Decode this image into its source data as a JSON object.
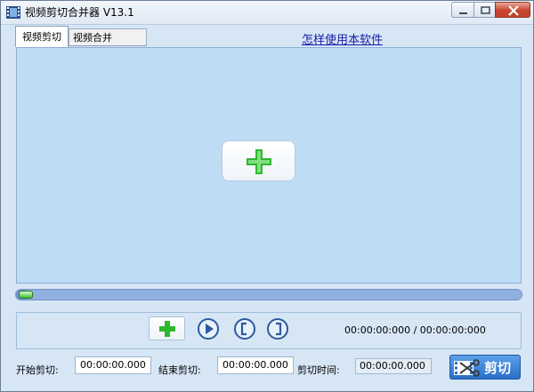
{
  "window": {
    "title": "视频剪切合并器 V13.1",
    "icon": "film-app-icon",
    "controls": [
      "minimize-icon",
      "maximize-icon",
      "close-icon"
    ]
  },
  "tabs": [
    {
      "label": "视频剪切",
      "active": true
    },
    {
      "label": "视频合并",
      "active": false
    }
  ],
  "help_link": "怎样使用本软件",
  "video_area": {
    "add_button_icon": "green-plus-icon"
  },
  "progress": {
    "value": 0.02
  },
  "controls": {
    "add_icon": "green-plus-icon",
    "play_icon": "play-icon",
    "mark_in_icon": "bracket-open-icon",
    "mark_out_icon": "bracket-close-icon",
    "time_display": "00:00:00:000 / 00:00:00:000"
  },
  "trim": {
    "start_label": "开始剪切:",
    "start_value": "00:00:00.000",
    "end_label": "结束剪切:",
    "end_value": "00:00:00.000",
    "duration_label": "剪切时间:",
    "duration_value": "00:00:00.000",
    "cut_button_label": "剪切",
    "cut_button_icon": "scissors-film-icon"
  },
  "colors": {
    "background": "#d6e6f5",
    "video_area": "#bfdcf5",
    "accent_blue": "#2a6fc8",
    "green": "#2eb82e"
  }
}
